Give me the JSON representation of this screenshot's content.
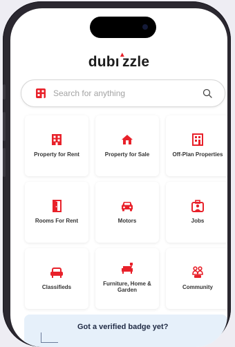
{
  "app": {
    "logo_text_a": "dub",
    "logo_text_b": "zzle"
  },
  "search": {
    "placeholder": "Search for anything",
    "icon": "search-icon"
  },
  "categories": [
    {
      "label": "Property for Rent",
      "icon": "building-icon"
    },
    {
      "label": "Property for Sale",
      "icon": "house-icon"
    },
    {
      "label": "Off-Plan Properties",
      "icon": "plan-building-icon"
    },
    {
      "label": "Rooms For Rent",
      "icon": "door-icon"
    },
    {
      "label": "Motors",
      "icon": "car-icon"
    },
    {
      "label": "Jobs",
      "icon": "briefcase-icon"
    },
    {
      "label": "Classifieds",
      "icon": "sofa-icon"
    },
    {
      "label": "Furniture, Home & Garden",
      "icon": "furniture-icon"
    },
    {
      "label": "Community",
      "icon": "people-icon"
    }
  ],
  "banner": {
    "text": "Got a verified badge yet?"
  },
  "colors": {
    "accent": "#e8212a",
    "banner_bg": "#e6f0fa"
  }
}
